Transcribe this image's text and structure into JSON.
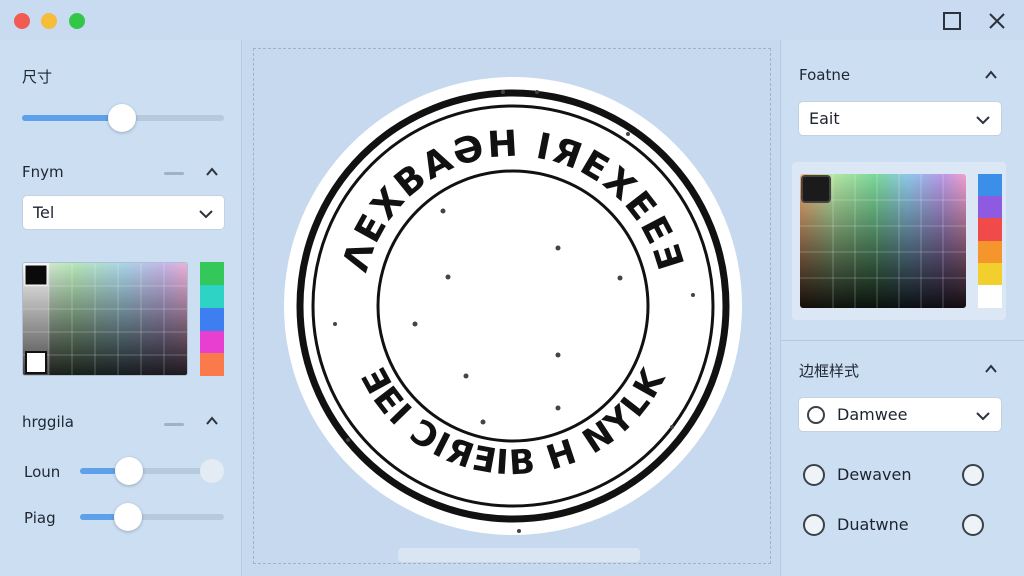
{
  "left": {
    "size_label": "尺寸",
    "size_level": 0.5,
    "font_label": "Fnym",
    "font_select": "Tel",
    "highlight_label": "hrggila",
    "loun_label": "Loun",
    "loun_level": 0.26,
    "piag_label": "Piag",
    "piag_level": 0.25
  },
  "right": {
    "font_label": "Foatne",
    "font_select": "Eait",
    "border_style_label": "边框样式",
    "border_select": "Damwee",
    "radio1_label": "Dewaven",
    "radio2_label": "Duatwne"
  },
  "stamp": {
    "top_text": "ΛEXBAƏH  IЯEXEEƎ",
    "bottom_text": "ƎEI  ƆIЯƎIB  H  NYLK"
  },
  "colors": {
    "accent": "#5ea0ea",
    "left_strip": [
      "#34c759",
      "#2fd3c5",
      "#3d7ff0",
      "#e83fd0",
      "#fb7a4b"
    ],
    "right_strip": [
      "#3b8fe8",
      "#8e5be0",
      "#f04a4a",
      "#f5962d",
      "#f2cf2c",
      "#ffffff"
    ]
  }
}
